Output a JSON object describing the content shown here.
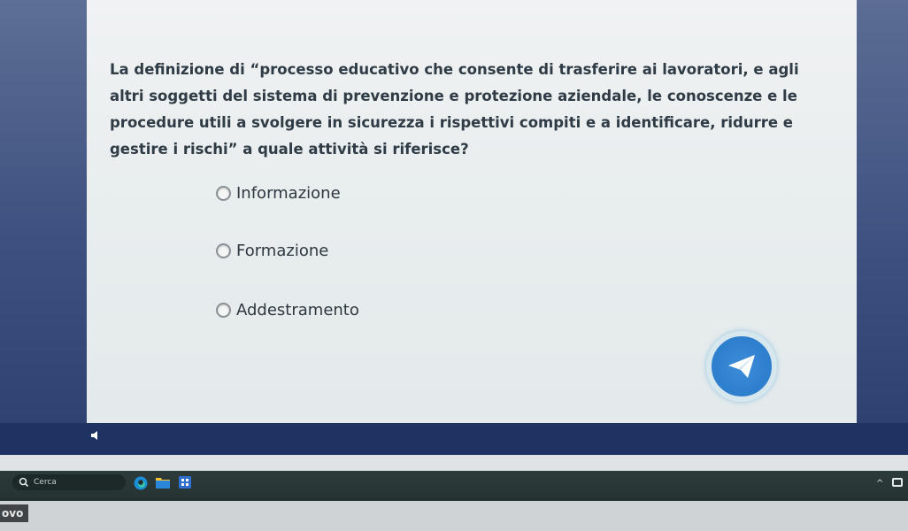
{
  "quiz": {
    "question": "La definizione di “processo educativo che consente di trasferire ai lavoratori, e agli altri soggetti del sistema di prevenzione e protezione aziendale, le conoscenze e le procedure utili a svolgere in sicurezza i rispettivi compiti e a identificare, ridurre e gestire i rischi” a quale attività si riferisce?",
    "options": [
      {
        "label": "Informazione"
      },
      {
        "label": "Formazione"
      },
      {
        "label": "Addestramento"
      }
    ],
    "send_icon": "paper-plane-icon"
  },
  "taskbar": {
    "search_label": "Cerca",
    "icons": [
      "search-icon",
      "edge-icon",
      "folder-icon",
      "store-icon",
      "chevron-up-icon",
      "battery-icon"
    ]
  },
  "bottom": {
    "brand": "ovo"
  },
  "colors": {
    "card_bg": "#eceff0",
    "stage_bg": "#2b3c66",
    "send_button": "#2f7fcf",
    "taskbar": "#2a3636"
  }
}
